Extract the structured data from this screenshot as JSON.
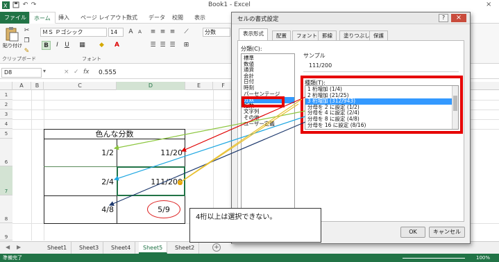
{
  "window": {
    "title": "Book1 - Excel"
  },
  "ribbon_tabs": [
    "ファイル",
    "ホーム",
    "挿入",
    "ページ レイアウト",
    "数式",
    "データ",
    "校閲",
    "表示"
  ],
  "ribbon": {
    "paste_label": "貼り付け",
    "clipboard_group": "クリップボード",
    "font_name": "ＭＳ Ｐゴシック",
    "font_size": "14",
    "font_group": "フォント",
    "bold": "B",
    "italic": "I",
    "underline": "U",
    "format_label": "分数"
  },
  "formula_bar": {
    "name_box": "D8",
    "fx": "fx",
    "value": "0.555"
  },
  "columns": [
    "A",
    "B",
    "C",
    "D",
    "E",
    "F"
  ],
  "rows": [
    "1",
    "2",
    "3",
    "4",
    "5",
    "6",
    "7",
    "8",
    "9"
  ],
  "table": {
    "title": "色んな分数",
    "rows": [
      {
        "c": "1/2",
        "d": "11/20"
      },
      {
        "c": "2/4",
        "d": "111/200"
      },
      {
        "c": "4/8",
        "d": "5/9"
      }
    ]
  },
  "sheets": [
    "Sheet1",
    "Sheet3",
    "Sheet4",
    "Sheet5",
    "Sheet2"
  ],
  "active_sheet": "Sheet5",
  "status": {
    "ready": "準備完了",
    "zoom": "100%"
  },
  "dialog": {
    "title": "セルの書式設定",
    "tabs": [
      "表示形式",
      "配置",
      "フォント",
      "罫線",
      "塗りつぶし",
      "保護"
    ],
    "category_label": "分類(C):",
    "categories": [
      "標準",
      "数値",
      "通貨",
      "会計",
      "日付",
      "時刻",
      "パーセンテージ",
      "分数",
      "指数",
      "文字列",
      "その他",
      "ユーザー定義"
    ],
    "selected_category": "分数",
    "sample_label": "サンプル",
    "sample_value": "111/200",
    "type_label": "種類(T):",
    "types": [
      "1 桁増加 (1/4)",
      "2 桁増加 (21/25)",
      "3 桁増加 (312/943)",
      "分母を 2 に設定 (1/2)",
      "分母を 4 に設定 (2/4)",
      "分母を 8 に設定 (4/8)",
      "分母を 16 に設定 (8/16)"
    ],
    "selected_type": "3 桁増加 (312/943)",
    "ok": "OK",
    "cancel": "キャンセル",
    "help": "?",
    "close": "×"
  },
  "callout": "4桁以上は選択できない。",
  "colors": {
    "excel_green": "#217346",
    "highlight_red": "#e60000",
    "selection_blue": "#3399ff"
  }
}
